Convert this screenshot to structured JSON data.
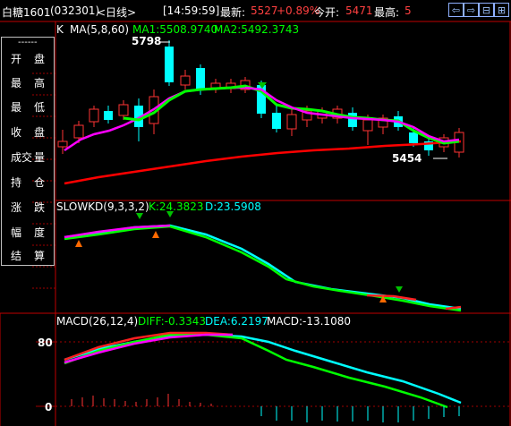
{
  "header": {
    "title": "白糖1601",
    "code": "(032301)",
    "period": "<日线>",
    "time": "[14:59:59]",
    "last_label": "最新:",
    "last_value": "5527",
    "change": "+0.89%",
    "open_label": "今开:",
    "open_value": "5471",
    "high_label": "最高:",
    "high_value": "5",
    "tools": [
      "⇦",
      "⇨",
      "⊟",
      "⊞"
    ]
  },
  "sidebar": {
    "dash": "------",
    "items": [
      {
        "a": "开",
        "b": "盘"
      },
      {
        "a": "最",
        "b": "高"
      },
      {
        "a": "最",
        "b": "低"
      },
      {
        "a": "收",
        "b": "盘"
      },
      {
        "a": "成交",
        "b": "量"
      },
      {
        "a": "持",
        "b": "仓"
      },
      {
        "a": "涨",
        "b": "跌"
      },
      {
        "a": "幅",
        "b": "度"
      },
      {
        "a": "结",
        "b": "算"
      }
    ]
  },
  "main_panel": {
    "prefix": "K",
    "ma": "MA(5,8,60)",
    "ma1": "MA1:5508.9740",
    "ma2": "MA2:5492.3743",
    "high_mark": "5798",
    "low_mark": "5454"
  },
  "kd_panel": {
    "name": "SLOWKD(9,3,3,2)",
    "k": "K:24.3823",
    "d": "D:23.5908"
  },
  "macd_panel": {
    "name": "MACD(26,12,4)",
    "diff": "DIFF:-0.3343",
    "dea": "DEA:6.2197",
    "macd": "MACD:-13.1080",
    "tick_80": "80",
    "tick_0": "0"
  },
  "colors": {
    "up": "#ff3333",
    "down": "#00ffff",
    "ma1": "#00ff00",
    "ma2": "#ff00ff",
    "ma60": "#ff0000",
    "grid": "#a00000"
  }
}
